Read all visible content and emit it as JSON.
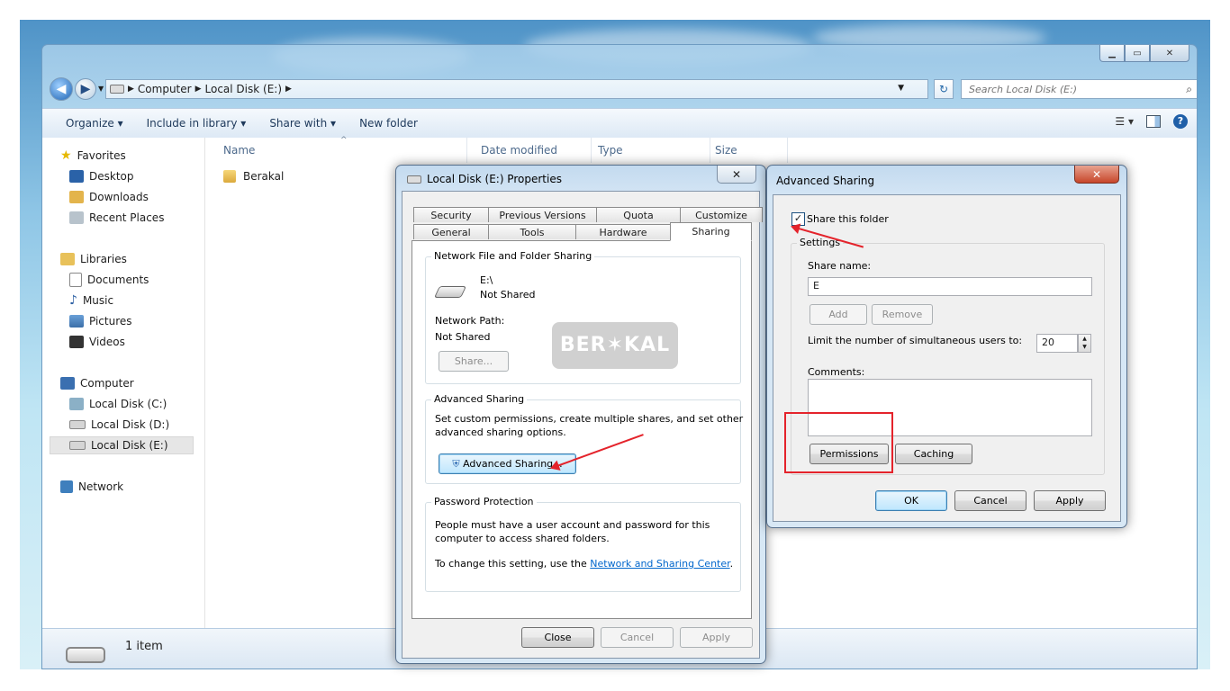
{
  "explorer": {
    "breadcrumb": [
      "Computer",
      "Local Disk (E:)"
    ],
    "search_placeholder": "Search Local Disk (E:)",
    "toolbar": {
      "organize": "Organize ▾",
      "include": "Include in library ▾",
      "share_with": "Share with ▾",
      "new_folder": "New folder"
    },
    "nav": {
      "favorites": "Favorites",
      "desktop": "Desktop",
      "downloads": "Downloads",
      "recent": "Recent Places",
      "libraries": "Libraries",
      "documents": "Documents",
      "music": "Music",
      "pictures": "Pictures",
      "videos": "Videos",
      "computer": "Computer",
      "disk_c": "Local Disk (C:)",
      "disk_d": "Local Disk (D:)",
      "disk_e": "Local Disk (E:)",
      "network": "Network"
    },
    "columns": {
      "name": "Name",
      "date": "Date modified",
      "type": "Type",
      "size": "Size"
    },
    "file": "Berakal",
    "status": "1 item"
  },
  "properties": {
    "title": "Local Disk (E:) Properties",
    "tabs_top": [
      "Security",
      "Previous Versions",
      "Quota",
      "Customize"
    ],
    "tabs_bottom": [
      "General",
      "Tools",
      "Hardware",
      "Sharing"
    ],
    "nfs": {
      "label": "Network File and Folder Sharing",
      "path": "E:\\",
      "state": "Not Shared",
      "network_path_label": "Network Path:",
      "network_path_value": "Not Shared",
      "share_btn": "Share..."
    },
    "adv": {
      "label": "Advanced Sharing",
      "desc1": "Set custom permissions, create multiple shares, and set other",
      "desc2": "advanced sharing options.",
      "btn": "Advanced Sharing..."
    },
    "pwd": {
      "label": "Password Protection",
      "desc1": "People must have a user account and password for this",
      "desc2": "computer to access shared folders.",
      "change_prefix": "To change this setting, use the ",
      "link": "Network and Sharing Center",
      "change_suffix": "."
    },
    "buttons": {
      "close": "Close",
      "cancel": "Cancel",
      "apply": "Apply"
    }
  },
  "watermark": "BER✶KAL",
  "advanced": {
    "title": "Advanced Sharing",
    "share_checkbox": "Share this folder",
    "settings": "Settings",
    "share_name_label": "Share name:",
    "share_name_value": "E",
    "add": "Add",
    "remove": "Remove",
    "limit_label": "Limit the number of simultaneous users to:",
    "limit_value": "20",
    "comments_label": "Comments:",
    "permissions": "Permissions",
    "caching": "Caching",
    "ok": "OK",
    "cancel": "Cancel",
    "apply": "Apply"
  },
  "colors": {
    "annotation": "#e4232b",
    "link": "#0066cc"
  }
}
